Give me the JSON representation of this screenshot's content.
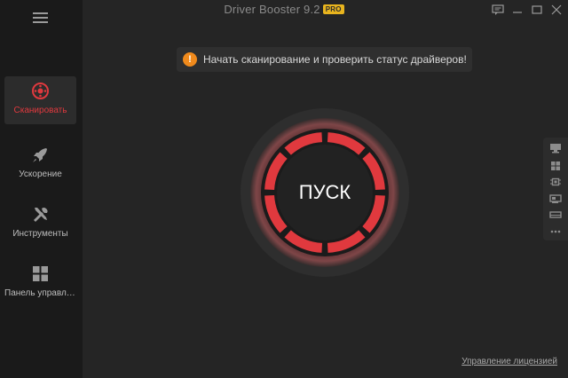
{
  "app": {
    "title": "Driver Booster 9.2",
    "edition_badge": "PRO"
  },
  "sidebar": {
    "items": [
      {
        "label": "Сканировать",
        "icon": "scan-target-icon",
        "active": true
      },
      {
        "label": "Ускорение",
        "icon": "rocket-icon",
        "active": false
      },
      {
        "label": "Инструменты",
        "icon": "tools-icon",
        "active": false
      },
      {
        "label": "Панель управления",
        "icon": "grid-icon",
        "active": false
      }
    ]
  },
  "notice": {
    "text": "Начать сканирование и проверить статус драйверов!",
    "icon": "info-icon"
  },
  "scan": {
    "button_label": "ПУСК"
  },
  "right_panel": {
    "icons": [
      "monitor-icon",
      "windows-icon",
      "chip-icon",
      "network-card-icon",
      "drive-icon",
      "more-icon"
    ]
  },
  "footer": {
    "license_link": "Управление лицензией"
  },
  "colors": {
    "accent_red": "#e0393e",
    "info_orange": "#f08a1c",
    "badge_yellow": "#e8b41e"
  }
}
